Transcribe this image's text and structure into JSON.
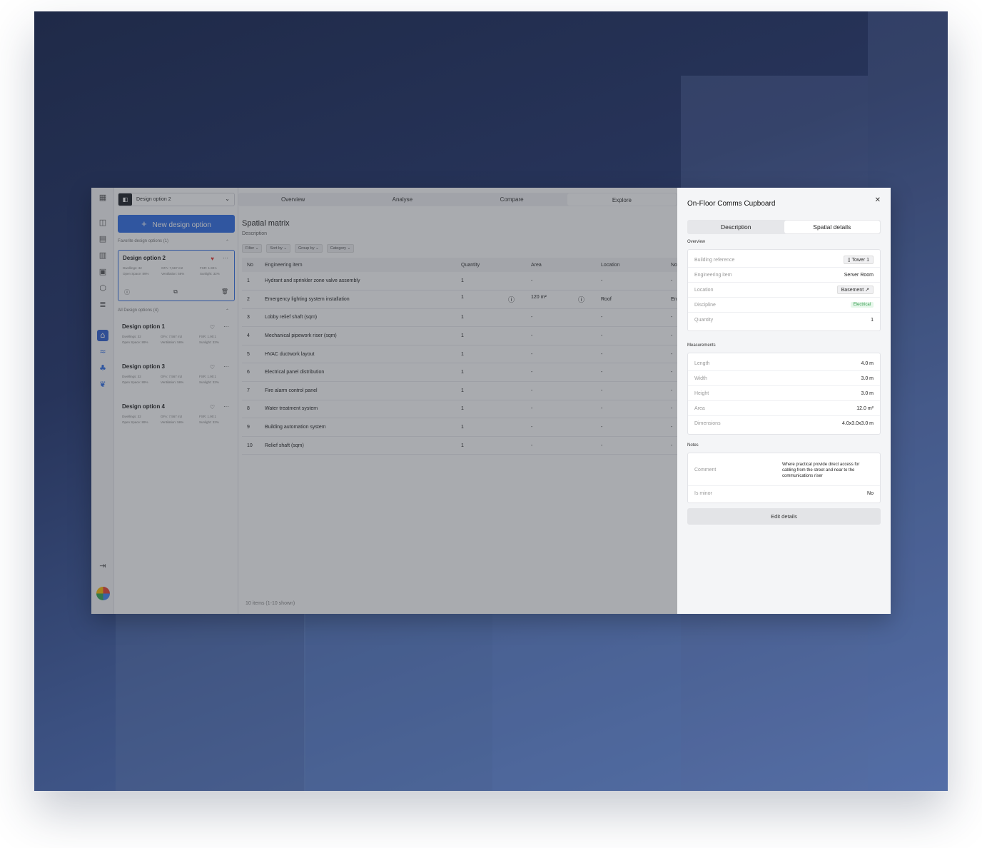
{
  "topbar": {
    "design_selector": "Design option 2",
    "tabs": [
      "Overview",
      "Analyse",
      "Compare",
      "Explore"
    ],
    "active_tab": "Explore"
  },
  "sidebar": {
    "new_button": "New design option",
    "favorites_header": "Favorite design options (1)",
    "all_header": "All Design options (4)",
    "favorites": [
      {
        "title": "Design option 2",
        "dwellings": "Dwellings: 32",
        "gfa": "GFA: 7,567 m2",
        "fsr": "FSR: 1.90:1",
        "open": "Open Space: 89%",
        "vent": "Ventilation: 56%",
        "sun": "Sunlight: 32%"
      }
    ],
    "options": [
      {
        "title": "Design option 1",
        "dwellings": "Dwellings: 32",
        "gfa": "GFA: 7,567 m2",
        "fsr": "FSR: 1.90:1",
        "open": "Open Space: 89%",
        "vent": "Ventilation: 56%",
        "sun": "Sunlight: 32%"
      },
      {
        "title": "Design option 3",
        "dwellings": "Dwellings: 32",
        "gfa": "GFA: 7,567 m2",
        "fsr": "FSR: 1.90:1",
        "open": "Open Space: 89%",
        "vent": "Ventilation: 56%",
        "sun": "Sunlight: 32%"
      },
      {
        "title": "Design option 4",
        "dwellings": "Dwellings: 32",
        "gfa": "GFA: 7,567 m2",
        "fsr": "FSR: 1.90:1",
        "open": "Open Space: 89%",
        "vent": "Ventilation: 56%",
        "sun": "Sunlight: 32%"
      }
    ]
  },
  "main": {
    "title": "Spatial matrix",
    "description": "Description",
    "chips": [
      "Filter",
      "Sort by",
      "Group by",
      "Category"
    ],
    "columns": [
      "No",
      "Engineering item",
      "Quantity",
      "Area",
      "Location",
      "No"
    ],
    "rows": [
      {
        "no": "1",
        "item": "Hydrant and sprinkler zone valve assembly",
        "qty": "1",
        "area": "-",
        "loc": "-",
        "extra": "-"
      },
      {
        "no": "2",
        "item": "Emergency lighting system installation",
        "qty": "1",
        "area": "120 m²",
        "loc": "Roof",
        "extra": "En"
      },
      {
        "no": "3",
        "item": "Lobby relief shaft (sqm)",
        "qty": "1",
        "area": "-",
        "loc": "-",
        "extra": "-"
      },
      {
        "no": "4",
        "item": "Mechanical pipework riser (sqm)",
        "qty": "1",
        "area": "-",
        "loc": "-",
        "extra": "-"
      },
      {
        "no": "5",
        "item": "HVAC ductwork layout",
        "qty": "1",
        "area": "-",
        "loc": "-",
        "extra": "-"
      },
      {
        "no": "6",
        "item": "Electrical panel distribution",
        "qty": "1",
        "area": "-",
        "loc": "-",
        "extra": "-"
      },
      {
        "no": "7",
        "item": "Fire alarm control panel",
        "qty": "1",
        "area": "-",
        "loc": "-",
        "extra": "-"
      },
      {
        "no": "8",
        "item": "Water treatment system",
        "qty": "1",
        "area": "-",
        "loc": "-",
        "extra": "-"
      },
      {
        "no": "9",
        "item": "Building automation system",
        "qty": "1",
        "area": "-",
        "loc": "-",
        "extra": "-"
      },
      {
        "no": "10",
        "item": "Relief shaft (sqm)",
        "qty": "1",
        "area": "-",
        "loc": "-",
        "extra": "-"
      }
    ],
    "footer": "10 items (1-10 shown)"
  },
  "panel": {
    "title": "On-Floor Comms Cupboard",
    "tabs": [
      "Description",
      "Spatial details"
    ],
    "active_tab": "Spatial details",
    "overview_label": "Overview",
    "overview": {
      "building_reference_label": "Building reference",
      "building_reference": "Tower 1",
      "engineering_item_label": "Engineering item",
      "engineering_item": "Server Room",
      "location_label": "Location",
      "location": "Basement",
      "discipline_label": "Discipline",
      "discipline": "Electrical",
      "quantity_label": "Quantity",
      "quantity": "1"
    },
    "measurements_label": "Measurements",
    "measurements": {
      "length_label": "Length",
      "length": "4.0 m",
      "width_label": "Width",
      "width": "3.0 m",
      "height_label": "Height",
      "height": "3.0 m",
      "area_label": "Area",
      "area": "12.0 m²",
      "dimensions_label": "Dimensions",
      "dimensions": "4.0x3.0x3.0 m"
    },
    "notes_label": "Notes",
    "notes": {
      "comment_label": "Comment",
      "comment": "Where practical provide direct access for cabling from the street and near to the communications riser",
      "is_minor_label": "Is minor",
      "is_minor": "No"
    },
    "edit_button": "Edit details"
  },
  "colors": {
    "accent": "#2f6de5",
    "favorite": "#e53935",
    "discipline_tag": "#2f9a4a"
  }
}
